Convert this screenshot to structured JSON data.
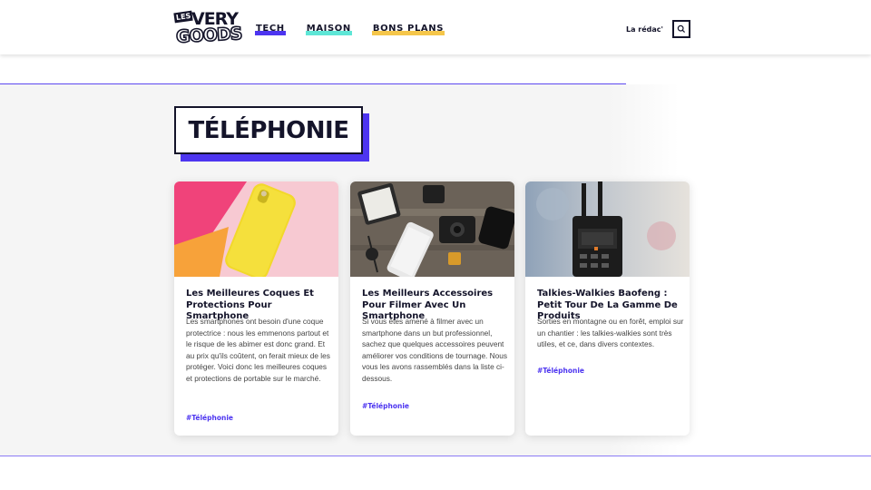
{
  "header": {
    "logo": {
      "les": "LES",
      "very": "VERY",
      "goods": "GOODS"
    },
    "nav": [
      {
        "label": "TECH",
        "color": "#4d35f0"
      },
      {
        "label": "MAISON",
        "color": "#5ee6d6"
      },
      {
        "label": "BONS PLANS",
        "color": "#f5c64a"
      }
    ],
    "redac_label": "La rédac'",
    "search_icon": "search-icon"
  },
  "section": {
    "title": "TÉLÉPHONIE",
    "accent": "#4d35f0"
  },
  "cards": [
    {
      "title": "Les Meilleures Coques Et Protections Pour Smartphone",
      "text": "Les smartphones ont besoin d'une coque protectrice : nous les emmenons partout et le risque de les abimer est donc grand. Et au prix qu'ils coûtent, on ferait mieux de les protéger. Voici donc les meilleures coques et protections de portable sur le marché.",
      "tag": "#Téléphonie",
      "image": "yellow-phone-case-photo"
    },
    {
      "title": "Les Meilleurs Accessoires Pour Filmer Avec Un Smartphone",
      "text": "Si vous êtes amené à filmer avec un smartphone dans un but professionnel, sachez que quelques accessoires peuvent améliorer vos conditions de tournage. Nous vous les avons rassemblés dans la liste ci-dessous.",
      "tag": "#Téléphonie",
      "image": "filming-accessories-photo"
    },
    {
      "title": "Talkies-Walkies Baofeng : Petit Tour De La Gamme De Produits",
      "text": "Sorties en montagne ou en forêt, emploi sur un chantier : les talkies-walkies sont très utiles, et ce, dans divers contextes.",
      "tag": "#Téléphonie",
      "image": "walkie-talkie-photo"
    }
  ]
}
